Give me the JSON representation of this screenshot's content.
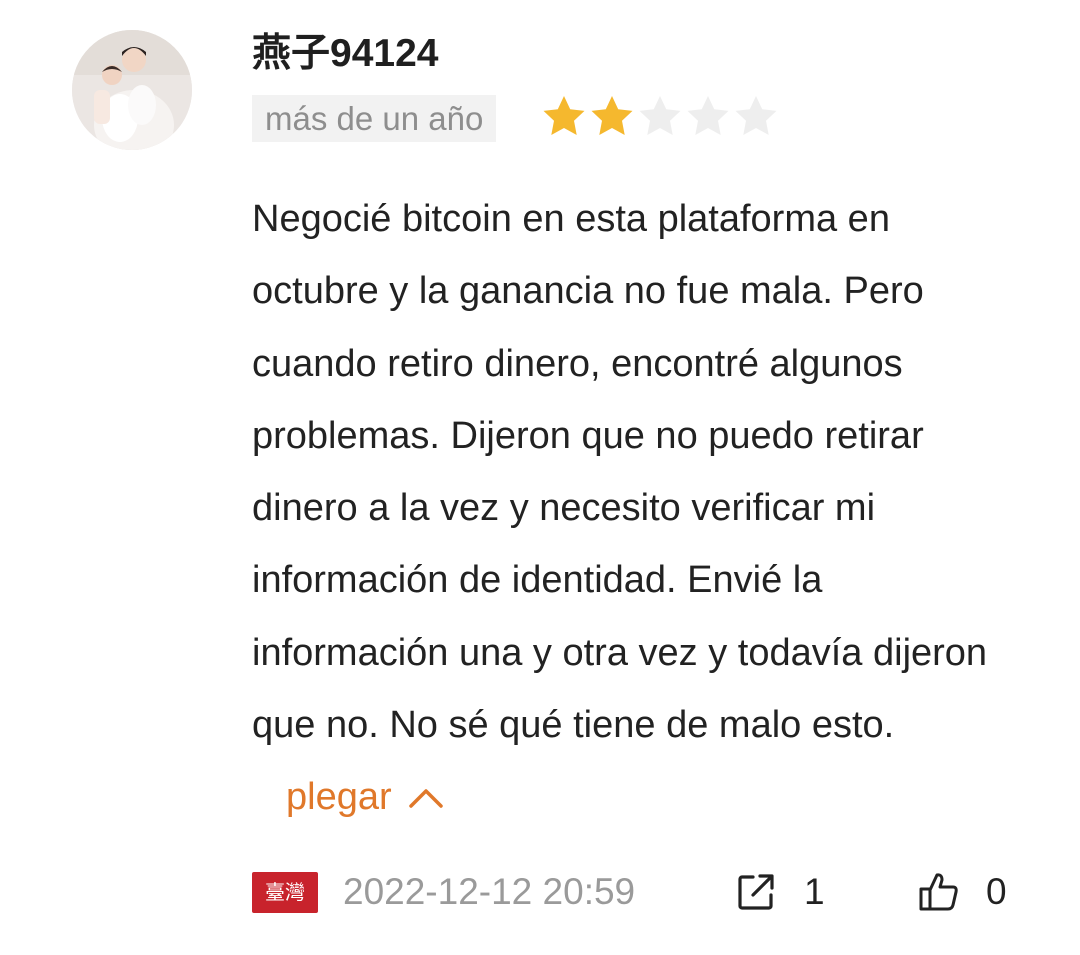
{
  "user": {
    "name_prefix": "燕子",
    "name_number": "94124",
    "avatar_icon": "user-photo-avatar"
  },
  "meta": {
    "time_ago": "más de un año",
    "rating": 2,
    "rating_max": 5,
    "colors": {
      "star_filled": "#f5b82e",
      "star_empty": "#eeeeee"
    }
  },
  "review": {
    "text": "Negocié bitcoin en esta plataforma en octubre y la ganancia no fue mala. Pero cuando retiro dinero, encontré algunos problemas. Dijeron que no puedo retirar dinero a la vez y necesito verificar mi información de identidad. Envié la información una y otra vez y todavía dijeron que no. No sé qué tiene de malo esto.",
    "collapse_label": "plegar",
    "collapse_icon": "chevron-up-icon",
    "colors": {
      "link": "#e0782a"
    }
  },
  "footer": {
    "region": "臺灣",
    "region_color": "#c8232c",
    "datetime": "2022-12-12 20:59",
    "share_icon": "share-icon",
    "share_count": "1",
    "like_icon": "thumbs-up-icon",
    "like_count": "0"
  }
}
